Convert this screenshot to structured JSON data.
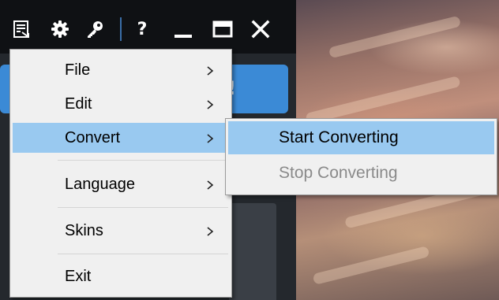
{
  "titlebar": {
    "icons": [
      "list-check-icon",
      "gear-icon",
      "key-icon",
      "help-icon",
      "minimize-icon",
      "maximize-icon",
      "close-icon"
    ],
    "help_label": "?"
  },
  "background": {
    "button_glyph": "!"
  },
  "menu": {
    "items": [
      {
        "label": "File",
        "has_submenu": true
      },
      {
        "label": "Edit",
        "has_submenu": true
      },
      {
        "label": "Convert",
        "has_submenu": true,
        "highlighted": true
      },
      {
        "label": "Language",
        "has_submenu": true
      },
      {
        "label": "Skins",
        "has_submenu": true
      },
      {
        "label": "Exit",
        "has_submenu": false
      }
    ]
  },
  "submenu": {
    "items": [
      {
        "label": "Start Converting",
        "highlighted": true,
        "enabled": true
      },
      {
        "label": "Stop Converting",
        "highlighted": false,
        "enabled": false
      }
    ]
  },
  "colors": {
    "highlight": "#99c9f0",
    "menu_background": "#f0f0f0",
    "titlebar": "#0f1114",
    "accent_blue": "#3b8ad6",
    "disabled_text": "#8a8a8a"
  }
}
